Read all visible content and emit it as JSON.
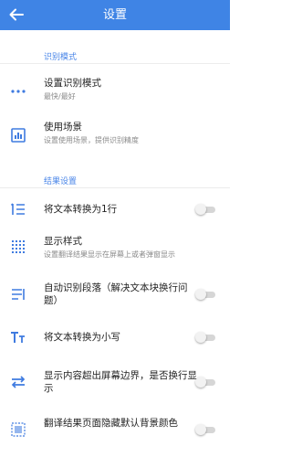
{
  "header": {
    "title": "设置",
    "back_icon": "arrow-left-icon"
  },
  "sections": {
    "recognition": {
      "title": "识别模式"
    },
    "results": {
      "title": "结果设置"
    }
  },
  "items": {
    "mode": {
      "label": "设置识别模式",
      "sub": "最快/最好",
      "icon": "more-dots-icon"
    },
    "scene": {
      "label": "使用场景",
      "sub": "设置使用场景，提供识别精度",
      "icon": "chart-icon"
    },
    "one_line": {
      "label": "将文本转换为1行",
      "icon": "list-numbered-icon",
      "toggle": false
    },
    "display_style": {
      "label": "显示样式",
      "sub": "设置翻译结果显示在屏幕上或者弹窗显示",
      "icon": "grid-dots-icon"
    },
    "auto_paragraph": {
      "label": "自动识别段落（解决文本块换行问题）",
      "icon": "paragraph-icon",
      "toggle": false
    },
    "lowercase": {
      "label": "将文本转换为小写",
      "icon": "text-case-icon",
      "toggle": false
    },
    "wrap": {
      "label": "显示内容超出屏幕边界，是否换行显示",
      "icon": "swap-icon",
      "toggle": false
    },
    "hide_bg": {
      "label": "翻译结果页面隐藏默认背景颜色",
      "icon": "background-icon",
      "toggle": false
    }
  },
  "colors": {
    "accent": "#3f84e5",
    "section_title": "#4a86e8",
    "icon": "#3f7be0"
  }
}
